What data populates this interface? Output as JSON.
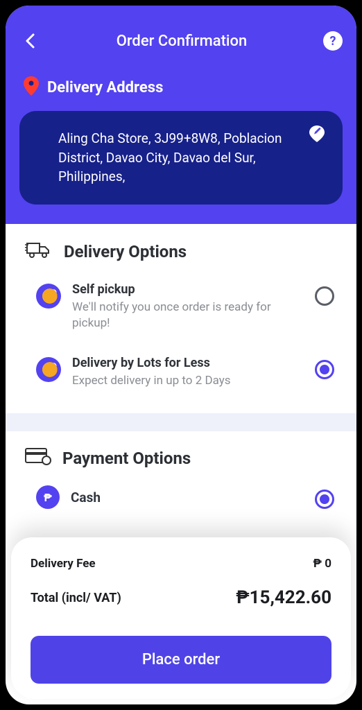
{
  "header": {
    "title": "Order Confirmation"
  },
  "address": {
    "section_label": "Delivery Address",
    "lines": "Aling Cha Store, 3J99+8W8, Poblacion District, Davao City, Davao del Sur, Philippines,"
  },
  "delivery": {
    "section_label": "Delivery Options",
    "options": [
      {
        "title": "Self pickup",
        "sub": "We'll notify you once order is ready for pickup!",
        "selected": false
      },
      {
        "title": "Delivery by Lots for Less",
        "sub": "Expect delivery in up to 2 Days",
        "selected": true
      }
    ]
  },
  "payment": {
    "section_label": "Payment Options",
    "options": [
      {
        "title": "Cash",
        "selected": true
      }
    ]
  },
  "summary": {
    "fee_label": "Delivery Fee",
    "fee_value": "₱ 0",
    "total_label": "Total (incl/ VAT)",
    "total_value": "₱15,422.60",
    "cta": "Place order"
  }
}
